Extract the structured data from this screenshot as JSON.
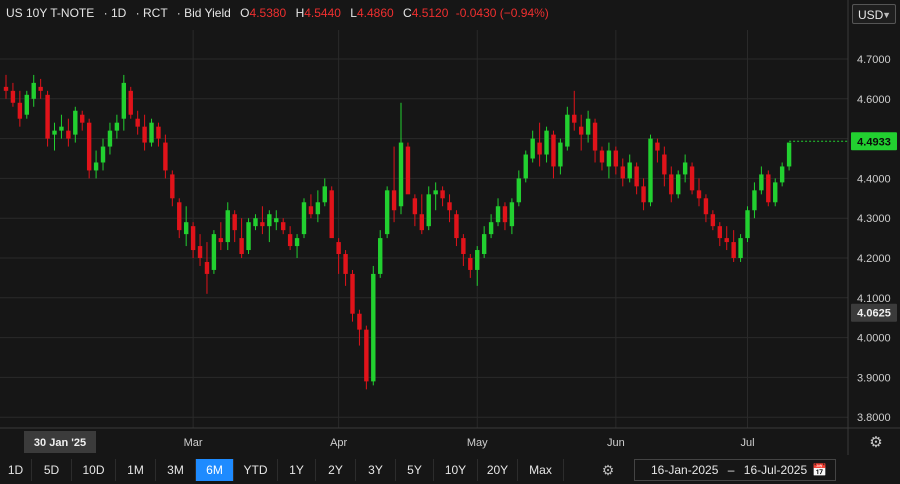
{
  "legend": {
    "symbol": "US 10Y T-NOTE",
    "interval": "1D",
    "source": "RCT",
    "field": "Bid Yield",
    "open_label": "O",
    "open": "4.5380",
    "high_label": "H",
    "high": "4.5440",
    "low_label": "L",
    "low": "4.4860",
    "close_label": "C",
    "close": "4.5120",
    "change": "-0.0430 (−0.94%)"
  },
  "currency": {
    "label": "USD",
    "icon": "chevron-down-icon"
  },
  "price_tags": {
    "last": "4.4933",
    "marker": "4.0625"
  },
  "crosshair_label": "30 Jan '25",
  "ranges": [
    "1D",
    "5D",
    "10D",
    "1M",
    "3M",
    "6M",
    "YTD",
    "1Y",
    "2Y",
    "3Y",
    "5Y",
    "10Y",
    "20Y",
    "Max"
  ],
  "active_range": "6M",
  "date_range": {
    "from": "16-Jan-2025",
    "separator": "–",
    "to": "16-Jul-2025",
    "icon": "calendar-icon"
  },
  "colors": {
    "up": "#22d030",
    "down": "#e0131a",
    "background": "#161616",
    "grid": "#2a2a2a",
    "last_tag": "#22d030",
    "active": "#1e8bff"
  },
  "chart_data": {
    "type": "candlestick",
    "title": "US 10Y T-NOTE",
    "ylim": [
      3.76,
      4.78
    ],
    "y_ticks": [
      "4.7000",
      "4.6000",
      "4.5000",
      "4.4000",
      "4.3000",
      "4.2000",
      "4.1000",
      "4.0000",
      "3.9000",
      "3.8000"
    ],
    "x_tick_labels": [
      {
        "label": "Mar",
        "index": 27
      },
      {
        "label": "Apr",
        "index": 48
      },
      {
        "label": "May",
        "index": 68
      },
      {
        "label": "Jun",
        "index": 88
      },
      {
        "label": "Jul",
        "index": 107
      }
    ],
    "ohlc": [
      [
        4.63,
        4.66,
        4.6,
        4.62
      ],
      [
        4.62,
        4.64,
        4.58,
        4.59
      ],
      [
        4.59,
        4.62,
        4.53,
        4.55
      ],
      [
        4.56,
        4.62,
        4.55,
        4.61
      ],
      [
        4.6,
        4.66,
        4.58,
        4.64
      ],
      [
        4.63,
        4.65,
        4.6,
        4.62
      ],
      [
        4.61,
        4.62,
        4.48,
        4.5
      ],
      [
        4.51,
        4.54,
        4.47,
        4.52
      ],
      [
        4.52,
        4.56,
        4.5,
        4.53
      ],
      [
        4.52,
        4.55,
        4.48,
        4.5
      ],
      [
        4.51,
        4.58,
        4.49,
        4.57
      ],
      [
        4.56,
        4.57,
        4.52,
        4.54
      ],
      [
        4.54,
        4.55,
        4.4,
        4.42
      ],
      [
        4.42,
        4.47,
        4.4,
        4.44
      ],
      [
        4.44,
        4.5,
        4.42,
        4.48
      ],
      [
        4.48,
        4.54,
        4.46,
        4.52
      ],
      [
        4.52,
        4.56,
        4.5,
        4.54
      ],
      [
        4.55,
        4.66,
        4.52,
        4.64
      ],
      [
        4.62,
        4.63,
        4.55,
        4.56
      ],
      [
        4.55,
        4.57,
        4.51,
        4.53
      ],
      [
        4.53,
        4.56,
        4.47,
        4.49
      ],
      [
        4.49,
        4.55,
        4.48,
        4.54
      ],
      [
        4.53,
        4.54,
        4.48,
        4.5
      ],
      [
        4.49,
        4.51,
        4.4,
        4.42
      ],
      [
        4.41,
        4.42,
        4.33,
        4.35
      ],
      [
        4.34,
        4.35,
        4.25,
        4.27
      ],
      [
        4.26,
        4.33,
        4.23,
        4.29
      ],
      [
        4.28,
        4.29,
        4.2,
        4.22
      ],
      [
        4.23,
        4.26,
        4.18,
        4.2
      ],
      [
        4.19,
        4.24,
        4.11,
        4.16
      ],
      [
        4.17,
        4.27,
        4.16,
        4.26
      ],
      [
        4.25,
        4.29,
        4.22,
        4.24
      ],
      [
        4.24,
        4.34,
        4.22,
        4.32
      ],
      [
        4.31,
        4.32,
        4.24,
        4.27
      ],
      [
        4.25,
        4.3,
        4.2,
        4.21
      ],
      [
        4.22,
        4.3,
        4.21,
        4.29
      ],
      [
        4.28,
        4.31,
        4.27,
        4.3
      ],
      [
        4.29,
        4.33,
        4.26,
        4.28
      ],
      [
        4.28,
        4.32,
        4.24,
        4.31
      ],
      [
        4.29,
        4.32,
        4.27,
        4.3
      ],
      [
        4.29,
        4.3,
        4.26,
        4.27
      ],
      [
        4.26,
        4.28,
        4.22,
        4.23
      ],
      [
        4.23,
        4.26,
        4.2,
        4.25
      ],
      [
        4.26,
        4.35,
        4.25,
        4.34
      ],
      [
        4.33,
        4.36,
        4.3,
        4.31
      ],
      [
        4.31,
        4.37,
        4.29,
        4.34
      ],
      [
        4.34,
        4.4,
        4.33,
        4.38
      ],
      [
        4.37,
        4.38,
        4.29,
        4.25
      ],
      [
        4.24,
        4.25,
        4.16,
        4.21
      ],
      [
        4.21,
        4.22,
        4.13,
        4.16
      ],
      [
        4.16,
        4.17,
        4.04,
        4.06
      ],
      [
        4.06,
        4.07,
        3.98,
        4.02
      ],
      [
        4.02,
        4.03,
        3.87,
        3.89
      ],
      [
        3.89,
        4.18,
        3.88,
        4.16
      ],
      [
        4.16,
        4.27,
        4.15,
        4.25
      ],
      [
        4.26,
        4.38,
        4.25,
        4.37
      ],
      [
        4.37,
        4.48,
        4.29,
        4.32
      ],
      [
        4.33,
        4.59,
        4.31,
        4.49
      ],
      [
        4.48,
        4.49,
        4.4,
        4.36
      ],
      [
        4.35,
        4.36,
        4.28,
        4.31
      ],
      [
        4.31,
        4.36,
        4.26,
        4.27
      ],
      [
        4.28,
        4.38,
        4.27,
        4.36
      ],
      [
        4.36,
        4.39,
        4.32,
        4.37
      ],
      [
        4.37,
        4.38,
        4.33,
        4.35
      ],
      [
        4.34,
        4.36,
        4.29,
        4.32
      ],
      [
        4.31,
        4.32,
        4.23,
        4.25
      ],
      [
        4.25,
        4.26,
        4.18,
        4.21
      ],
      [
        4.2,
        4.21,
        4.15,
        4.17
      ],
      [
        4.17,
        4.23,
        4.13,
        4.22
      ],
      [
        4.21,
        4.28,
        4.2,
        4.26
      ],
      [
        4.26,
        4.31,
        4.25,
        4.29
      ],
      [
        4.29,
        4.35,
        4.28,
        4.33
      ],
      [
        4.33,
        4.34,
        4.27,
        4.29
      ],
      [
        4.28,
        4.35,
        4.26,
        4.34
      ],
      [
        4.34,
        4.42,
        4.33,
        4.4
      ],
      [
        4.4,
        4.47,
        4.39,
        4.46
      ],
      [
        4.45,
        4.52,
        4.44,
        4.5
      ],
      [
        4.49,
        4.54,
        4.43,
        4.46
      ],
      [
        4.46,
        4.53,
        4.44,
        4.52
      ],
      [
        4.51,
        4.52,
        4.4,
        4.43
      ],
      [
        4.43,
        4.5,
        4.41,
        4.49
      ],
      [
        4.48,
        4.58,
        4.47,
        4.56
      ],
      [
        4.56,
        4.62,
        4.52,
        4.54
      ],
      [
        4.53,
        4.56,
        4.47,
        4.51
      ],
      [
        4.51,
        4.57,
        4.49,
        4.55
      ],
      [
        4.54,
        4.55,
        4.44,
        4.47
      ],
      [
        4.47,
        4.48,
        4.42,
        4.44
      ],
      [
        4.43,
        4.49,
        4.4,
        4.47
      ],
      [
        4.47,
        4.48,
        4.41,
        4.43
      ],
      [
        4.43,
        4.45,
        4.38,
        4.4
      ],
      [
        4.4,
        4.46,
        4.39,
        4.44
      ],
      [
        4.43,
        4.44,
        4.36,
        4.38
      ],
      [
        4.38,
        4.4,
        4.32,
        4.34
      ],
      [
        4.34,
        4.51,
        4.33,
        4.5
      ],
      [
        4.49,
        4.5,
        4.44,
        4.47
      ],
      [
        4.46,
        4.48,
        4.38,
        4.41
      ],
      [
        4.41,
        4.43,
        4.34,
        4.36
      ],
      [
        4.36,
        4.42,
        4.35,
        4.41
      ],
      [
        4.41,
        4.46,
        4.39,
        4.44
      ],
      [
        4.43,
        4.44,
        4.36,
        4.37
      ],
      [
        4.37,
        4.4,
        4.33,
        4.35
      ],
      [
        4.35,
        4.36,
        4.29,
        4.31
      ],
      [
        4.31,
        4.32,
        4.27,
        4.28
      ],
      [
        4.28,
        4.29,
        4.23,
        4.25
      ],
      [
        4.25,
        4.28,
        4.22,
        4.24
      ],
      [
        4.24,
        4.27,
        4.19,
        4.2
      ],
      [
        4.2,
        4.26,
        4.19,
        4.25
      ],
      [
        4.25,
        4.33,
        4.24,
        4.32
      ],
      [
        4.32,
        4.39,
        4.3,
        4.37
      ],
      [
        4.37,
        4.43,
        4.36,
        4.41
      ],
      [
        4.41,
        4.42,
        4.33,
        4.34
      ],
      [
        4.34,
        4.4,
        4.33,
        4.39
      ],
      [
        4.39,
        4.44,
        4.38,
        4.43
      ],
      [
        4.43,
        4.49,
        4.42,
        4.49
      ]
    ]
  }
}
